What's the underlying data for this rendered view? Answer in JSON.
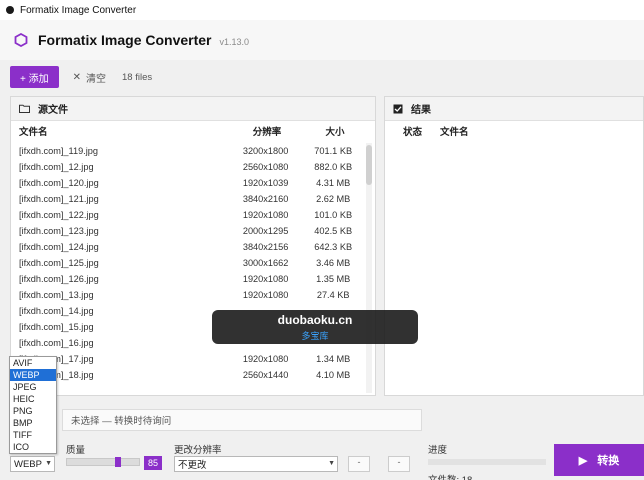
{
  "window": {
    "title": "Formatix Image Converter"
  },
  "header": {
    "app_name": "Formatix Image Converter",
    "version": "v1.13.0"
  },
  "toolbar": {
    "add_label": "+ 添加",
    "clear_label": "清空",
    "file_count": "18 files"
  },
  "source_panel": {
    "title": "源文件",
    "columns": {
      "name": "文件名",
      "resolution": "分辨率",
      "size": "大小"
    },
    "rows": [
      {
        "name": "[ifxdh.com]_119.jpg",
        "resolution": "3200x1800",
        "size": "701.1 KB"
      },
      {
        "name": "[ifxdh.com]_12.jpg",
        "resolution": "2560x1080",
        "size": "882.0 KB"
      },
      {
        "name": "[ifxdh.com]_120.jpg",
        "resolution": "1920x1039",
        "size": "4.31 MB"
      },
      {
        "name": "[ifxdh.com]_121.jpg",
        "resolution": "3840x2160",
        "size": "2.62 MB"
      },
      {
        "name": "[ifxdh.com]_122.jpg",
        "resolution": "1920x1080",
        "size": "101.0 KB"
      },
      {
        "name": "[ifxdh.com]_123.jpg",
        "resolution": "2000x1295",
        "size": "402.5 KB"
      },
      {
        "name": "[ifxdh.com]_124.jpg",
        "resolution": "3840x2156",
        "size": "642.3 KB"
      },
      {
        "name": "[ifxdh.com]_125.jpg",
        "resolution": "3000x1662",
        "size": "3.46 MB"
      },
      {
        "name": "[ifxdh.com]_126.jpg",
        "resolution": "1920x1080",
        "size": "1.35 MB"
      },
      {
        "name": "[ifxdh.com]_13.jpg",
        "resolution": "1920x1080",
        "size": "27.4 KB"
      },
      {
        "name": "[ifxdh.com]_14.jpg",
        "resolution": "",
        "size": ""
      },
      {
        "name": "[ifxdh.com]_15.jpg",
        "resolution": "",
        "size": ""
      },
      {
        "name": "[ifxdh.com]_16.jpg",
        "resolution": "",
        "size": ""
      },
      {
        "name": "[ifxdh.com]_17.jpg",
        "resolution": "1920x1080",
        "size": "1.34 MB"
      },
      {
        "name": "[ifxdh.com]_18.jpg",
        "resolution": "2560x1440",
        "size": "4.10 MB"
      }
    ]
  },
  "result_panel": {
    "title": "结果",
    "columns": {
      "status": "状态",
      "name": "文件名"
    }
  },
  "bottom": {
    "status_text": "未选择 — 转换时待询问",
    "quality_label": "质量",
    "quality_value": "85",
    "quality_fraction": 0.66,
    "resolution_label": "更改分辨率",
    "resolution_value": "不更改",
    "stepper_a": "-",
    "stepper_b": "-",
    "progress_label": "进度",
    "progress_fraction": 0,
    "file_count_text": "文件数: 18",
    "convert_label": "转换"
  },
  "format": {
    "selected": "WEBP",
    "options": [
      "AVIF",
      "WEBP",
      "JPEG",
      "HEIC",
      "PNG",
      "BMP",
      "TIFF",
      "ICO"
    ]
  },
  "watermark": {
    "line1": "duobaoku.cn",
    "line2": "多宝库"
  },
  "colors": {
    "accent": "#8b2fc9",
    "selection": "#1f6fd6"
  },
  "icons": {
    "app": "hexagon-logo-icon",
    "folder": "folder-icon",
    "check": "checkbox-icon",
    "clear": "close-icon",
    "play": "play-icon"
  }
}
